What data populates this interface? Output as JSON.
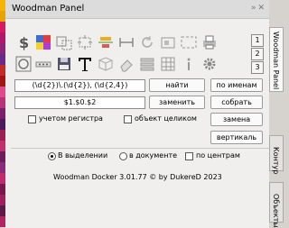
{
  "panel": {
    "title": "Woodman Panel"
  },
  "pages": [
    "1",
    "2",
    "3"
  ],
  "search": {
    "find_value": "(\\d{2})\\.(\\d{2}), (\\d{2,4})",
    "replace_value": "$1.$0.$2",
    "find_label": "найти",
    "replace_label": "заменить",
    "by_names_label": "по именам",
    "collect_label": "собрать",
    "swap_label": "замена",
    "vertical_label": "вертикаль",
    "case_label": "учетом регистра",
    "whole_label": "объект целиком"
  },
  "scope": {
    "selection_label": "В выделении",
    "document_label": "в документе",
    "centers_label": "по центрам"
  },
  "footer": {
    "credits": "Woodman Docker 3.01.77 © by DukereD 2023"
  },
  "side_tabs": {
    "woodman": "Woodman Panel",
    "kontur": "Контур",
    "objects": "Объекты"
  },
  "colors": {
    "swatches": [
      "#f5b400",
      "#e8a300",
      "#d81b60",
      "#b0176b",
      "#8e2478",
      "#6a2a8a",
      "#c42a2a",
      "#a31515",
      "#e04a8c",
      "#b83279",
      "#7b1f6a",
      "#4a1a5c",
      "#9c1f4f",
      "#c0306a",
      "#6e1d5a",
      "#8a2a7a",
      "#c22a6e",
      "#7a1750",
      "#a01f5f",
      "#5e1a48",
      "#b02460"
    ]
  }
}
